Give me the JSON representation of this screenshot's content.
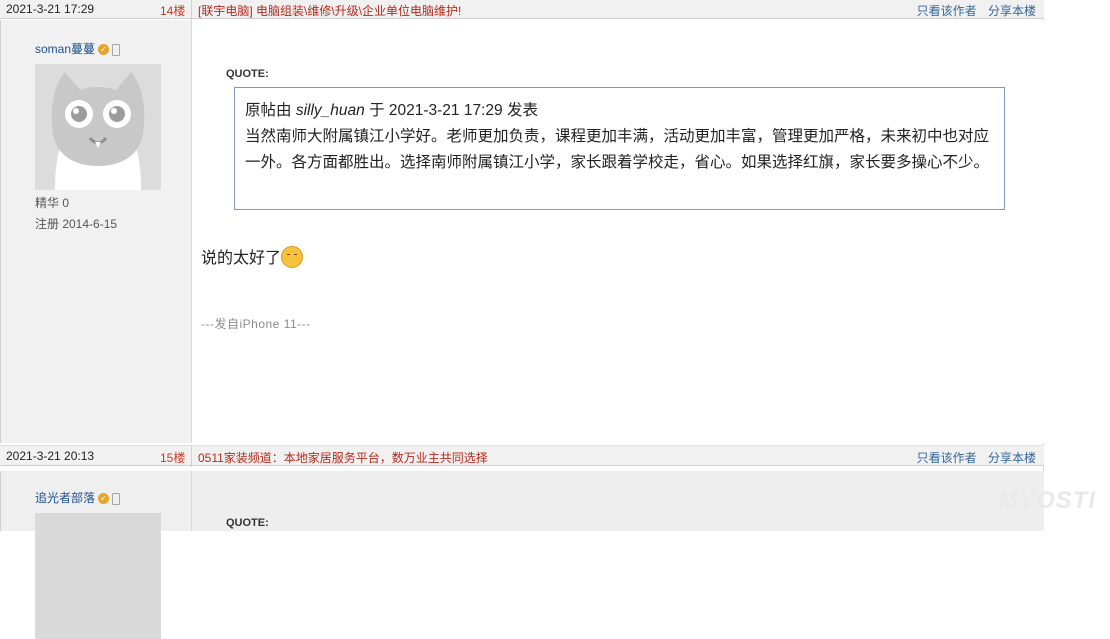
{
  "posts": [
    {
      "date": "2021-3-21 17:29",
      "floor": "14楼",
      "ad": "[联宇电脑] 电脑组装\\维修\\升级\\企业单位电脑维护!",
      "action_author_only": "只看该作者",
      "action_share": "分享本楼",
      "username": "soman蔓蔓",
      "stat_essence": "精华 0",
      "stat_register": "注册 2014-6-15",
      "quote_label": "QUOTE:",
      "quote_prefix": "原帖由",
      "quote_author": "silly_huan",
      "quote_mid": "于 2021-3-21 17:29 发表",
      "quote_text": "当然南师大附属镇江小学好。老师更加负责，课程更加丰满，活动更加丰富，管理更加严格，未来初中也对应一外。各方面都胜出。选择南师附属镇江小学，家长跟着学校走，省心。如果选择红旗，家长要多操心不少。",
      "reply_text": "说的太好了",
      "signature": "---发自iPhone 11---"
    },
    {
      "date": "2021-3-21 20:13",
      "floor": "15楼",
      "ad": "0511家装频道：本地家居服务平台，数万业主共同选择",
      "action_author_only": "只看该作者",
      "action_share": "分享本楼",
      "username": "追光者部落",
      "quote_label": "QUOTE:"
    }
  ],
  "watermark": "MYOSTI",
  "icons": {
    "badge": "verified-badge-icon",
    "phone": "mobile-phone-icon",
    "emoji": "blushing-emoji-icon"
  }
}
